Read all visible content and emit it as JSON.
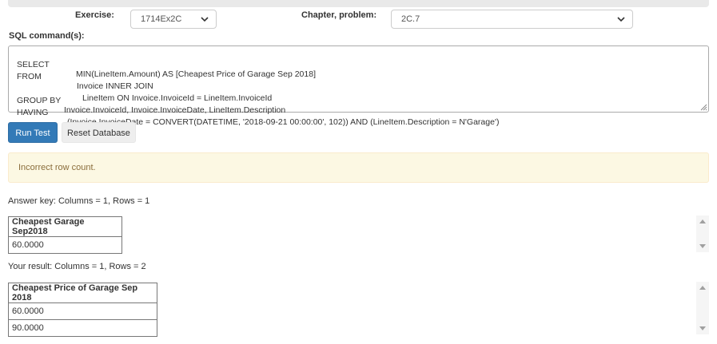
{
  "form": {
    "exercise_label": "Exercise:",
    "exercise_value": "1714Ex2C",
    "chapter_label": "Chapter, problem:",
    "chapter_value": "2C.7",
    "sql_label": "SQL command(s):"
  },
  "sql_lines": [
    {
      "keyword": "SELECT",
      "text": "MIN(LineItem.Amount) AS [Cheapest Price of Garage Sep 2018]"
    },
    {
      "keyword": "FROM",
      "text": "Invoice INNER JOIN"
    },
    {
      "keyword": "",
      "text": "LineItem ON Invoice.InvoiceId = LineItem.InvoiceId"
    },
    {
      "keyword": "GROUP BY",
      "text": "Invoice.InvoiceId, Invoice.InvoiceDate, LineItem.Description"
    },
    {
      "keyword": "HAVING",
      "text": "(Invoice.InvoiceDate = CONVERT(DATETIME, '2018-09-21 00:00:00', 102)) AND (LineItem.Description = N'Garage')"
    }
  ],
  "buttons": {
    "run_test": "Run Test",
    "reset_db": "Reset Database"
  },
  "alert": {
    "message": "Incorrect row count.",
    "color": "#fcf8e3"
  },
  "answer_key": {
    "summary": "Answer key: Columns = 1, Rows = 1",
    "header": "Cheapest Garage Sep2018",
    "rows": [
      "60.0000"
    ]
  },
  "your_result": {
    "summary": "Your result: Columns = 1, Rows = 2",
    "header": "Cheapest Price of Garage Sep 2018",
    "rows": [
      "60.0000",
      "90.0000"
    ]
  },
  "colors": {
    "primary": "#337ab7",
    "warning_text": "#8a6d3b"
  }
}
